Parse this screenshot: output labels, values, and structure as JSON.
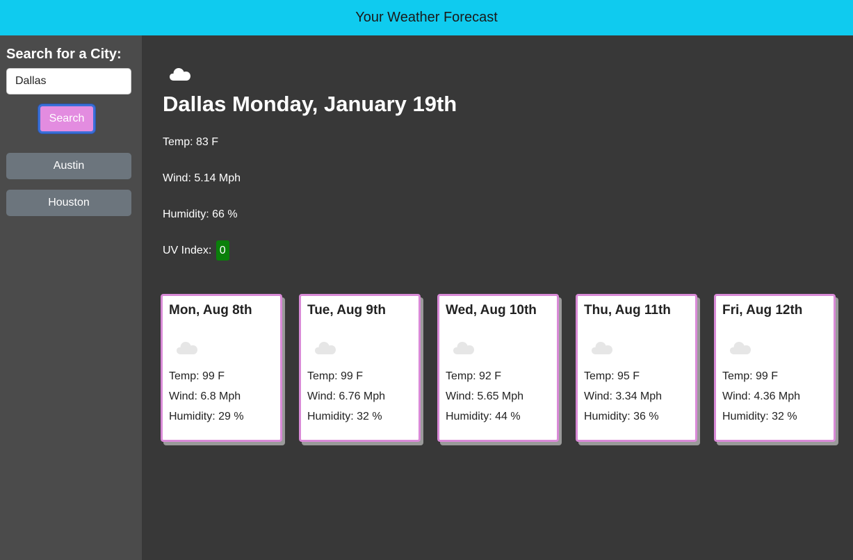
{
  "header": {
    "title": "Your Weather Forecast"
  },
  "sidebar": {
    "search_label": "Search for a City:",
    "search_value": "Dallas",
    "search_button": "Search",
    "history": [
      "Austin",
      "Houston"
    ]
  },
  "current": {
    "icon": "cloud-icon",
    "title": "Dallas Monday, January 19th",
    "temp": "Temp: 83 F",
    "wind": "Wind: 5.14 Mph",
    "humidity": "Humidity: 66 %",
    "uv_label": "UV Index:",
    "uv_value": "0"
  },
  "forecast": [
    {
      "date": "Mon, Aug 8th",
      "icon": "cloud-icon",
      "temp": "Temp: 99 F",
      "wind": "Wind: 6.8 Mph",
      "humidity": "Humidity: 29 %"
    },
    {
      "date": "Tue, Aug 9th",
      "icon": "cloud-icon",
      "temp": "Temp: 99 F",
      "wind": "Wind: 6.76 Mph",
      "humidity": "Humidity: 32 %"
    },
    {
      "date": "Wed, Aug 10th",
      "icon": "cloud-icon",
      "temp": "Temp: 92 F",
      "wind": "Wind: 5.65 Mph",
      "humidity": "Humidity: 44 %"
    },
    {
      "date": "Thu, Aug 11th",
      "icon": "cloud-icon",
      "temp": "Temp: 95 F",
      "wind": "Wind: 3.34 Mph",
      "humidity": "Humidity: 36 %"
    },
    {
      "date": "Fri, Aug 12th",
      "icon": "cloud-icon",
      "temp": "Temp: 99 F",
      "wind": "Wind: 4.36 Mph",
      "humidity": "Humidity: 32 %"
    }
  ],
  "colors": {
    "header_bg": "#0fcbef",
    "sidebar_bg": "#4b4b4b",
    "main_bg": "#383838",
    "search_button_bg": "#e38ce0",
    "history_button_bg": "#6c757d",
    "card_border": "#d98ad7",
    "uv_low": "#0a7f0a"
  }
}
